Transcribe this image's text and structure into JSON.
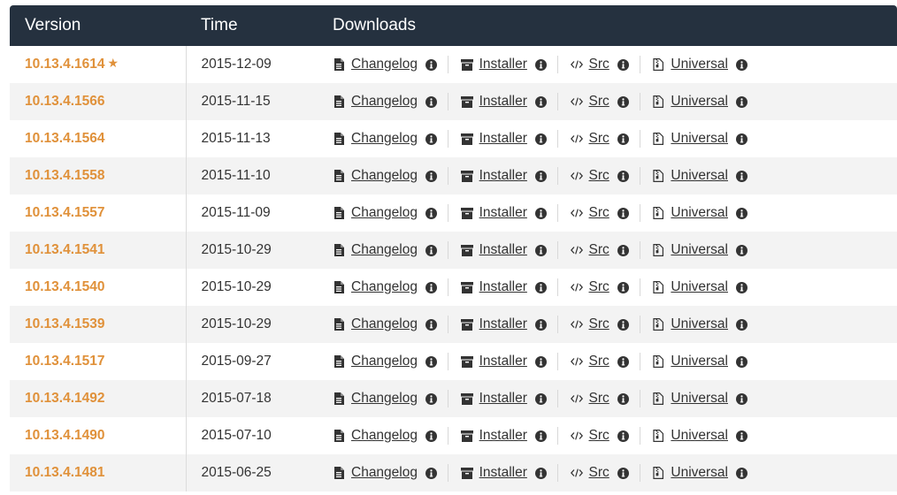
{
  "header": {
    "version": "Version",
    "time": "Time",
    "downloads": "Downloads"
  },
  "download_labels": {
    "changelog": " Changelog ",
    "installer": " Installer ",
    "src": " Src ",
    "universal": " Universal "
  },
  "icons": {
    "changelog": "document-icon",
    "installer": "archive-box-icon",
    "src": "code-icon",
    "universal": "file-zip-icon",
    "info": "info-circle-icon",
    "featured": "star-icon"
  },
  "colors": {
    "header_bg": "#25313f",
    "version_link": "#e0913a",
    "row_alt_bg": "#f3f3f3"
  },
  "releases": [
    {
      "version": "10.13.4.1614",
      "time": "2015-12-09",
      "featured": true
    },
    {
      "version": "10.13.4.1566",
      "time": "2015-11-15",
      "featured": false
    },
    {
      "version": "10.13.4.1564",
      "time": "2015-11-13",
      "featured": false
    },
    {
      "version": "10.13.4.1558",
      "time": "2015-11-10",
      "featured": false
    },
    {
      "version": "10.13.4.1557",
      "time": "2015-11-09",
      "featured": false
    },
    {
      "version": "10.13.4.1541",
      "time": "2015-10-29",
      "featured": false
    },
    {
      "version": "10.13.4.1540",
      "time": "2015-10-29",
      "featured": false
    },
    {
      "version": "10.13.4.1539",
      "time": "2015-10-29",
      "featured": false
    },
    {
      "version": "10.13.4.1517",
      "time": "2015-09-27",
      "featured": false
    },
    {
      "version": "10.13.4.1492",
      "time": "2015-07-18",
      "featured": false
    },
    {
      "version": "10.13.4.1490",
      "time": "2015-07-10",
      "featured": false
    },
    {
      "version": "10.13.4.1481",
      "time": "2015-06-25",
      "featured": false
    }
  ]
}
